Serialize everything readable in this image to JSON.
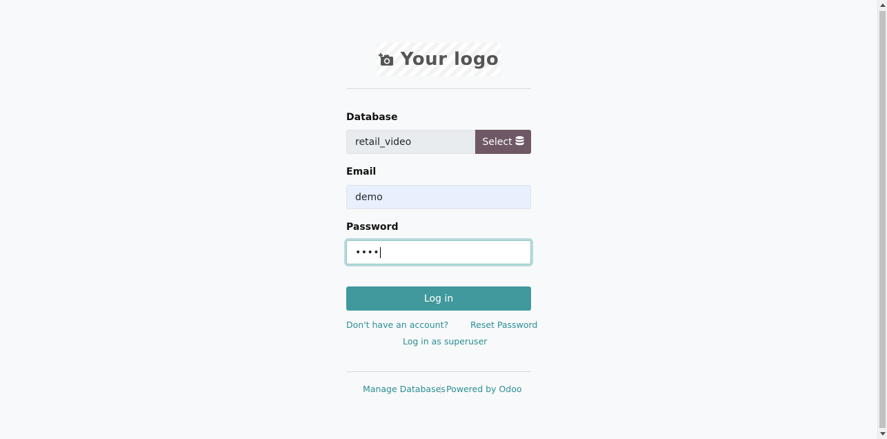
{
  "logo": {
    "text": "Your logo",
    "icon": "camera-plus-icon"
  },
  "form": {
    "database_label": "Database",
    "database_value": "retail_video",
    "select_label": "Select",
    "select_icon": "database-icon",
    "email_label": "Email",
    "email_value": "demo",
    "password_label": "Password",
    "password_value": "••••",
    "login_label": "Log in"
  },
  "links": {
    "signup": "Don't have an account?",
    "reset": "Reset Password",
    "superuser": "Log in as superuser",
    "manage_db": "Manage Databases",
    "powered": "Powered by Odoo"
  },
  "colors": {
    "primary": "#41999d",
    "select_button": "#6f5865",
    "link": "#2a8e94",
    "email_autofill": "#e8f0fe"
  }
}
